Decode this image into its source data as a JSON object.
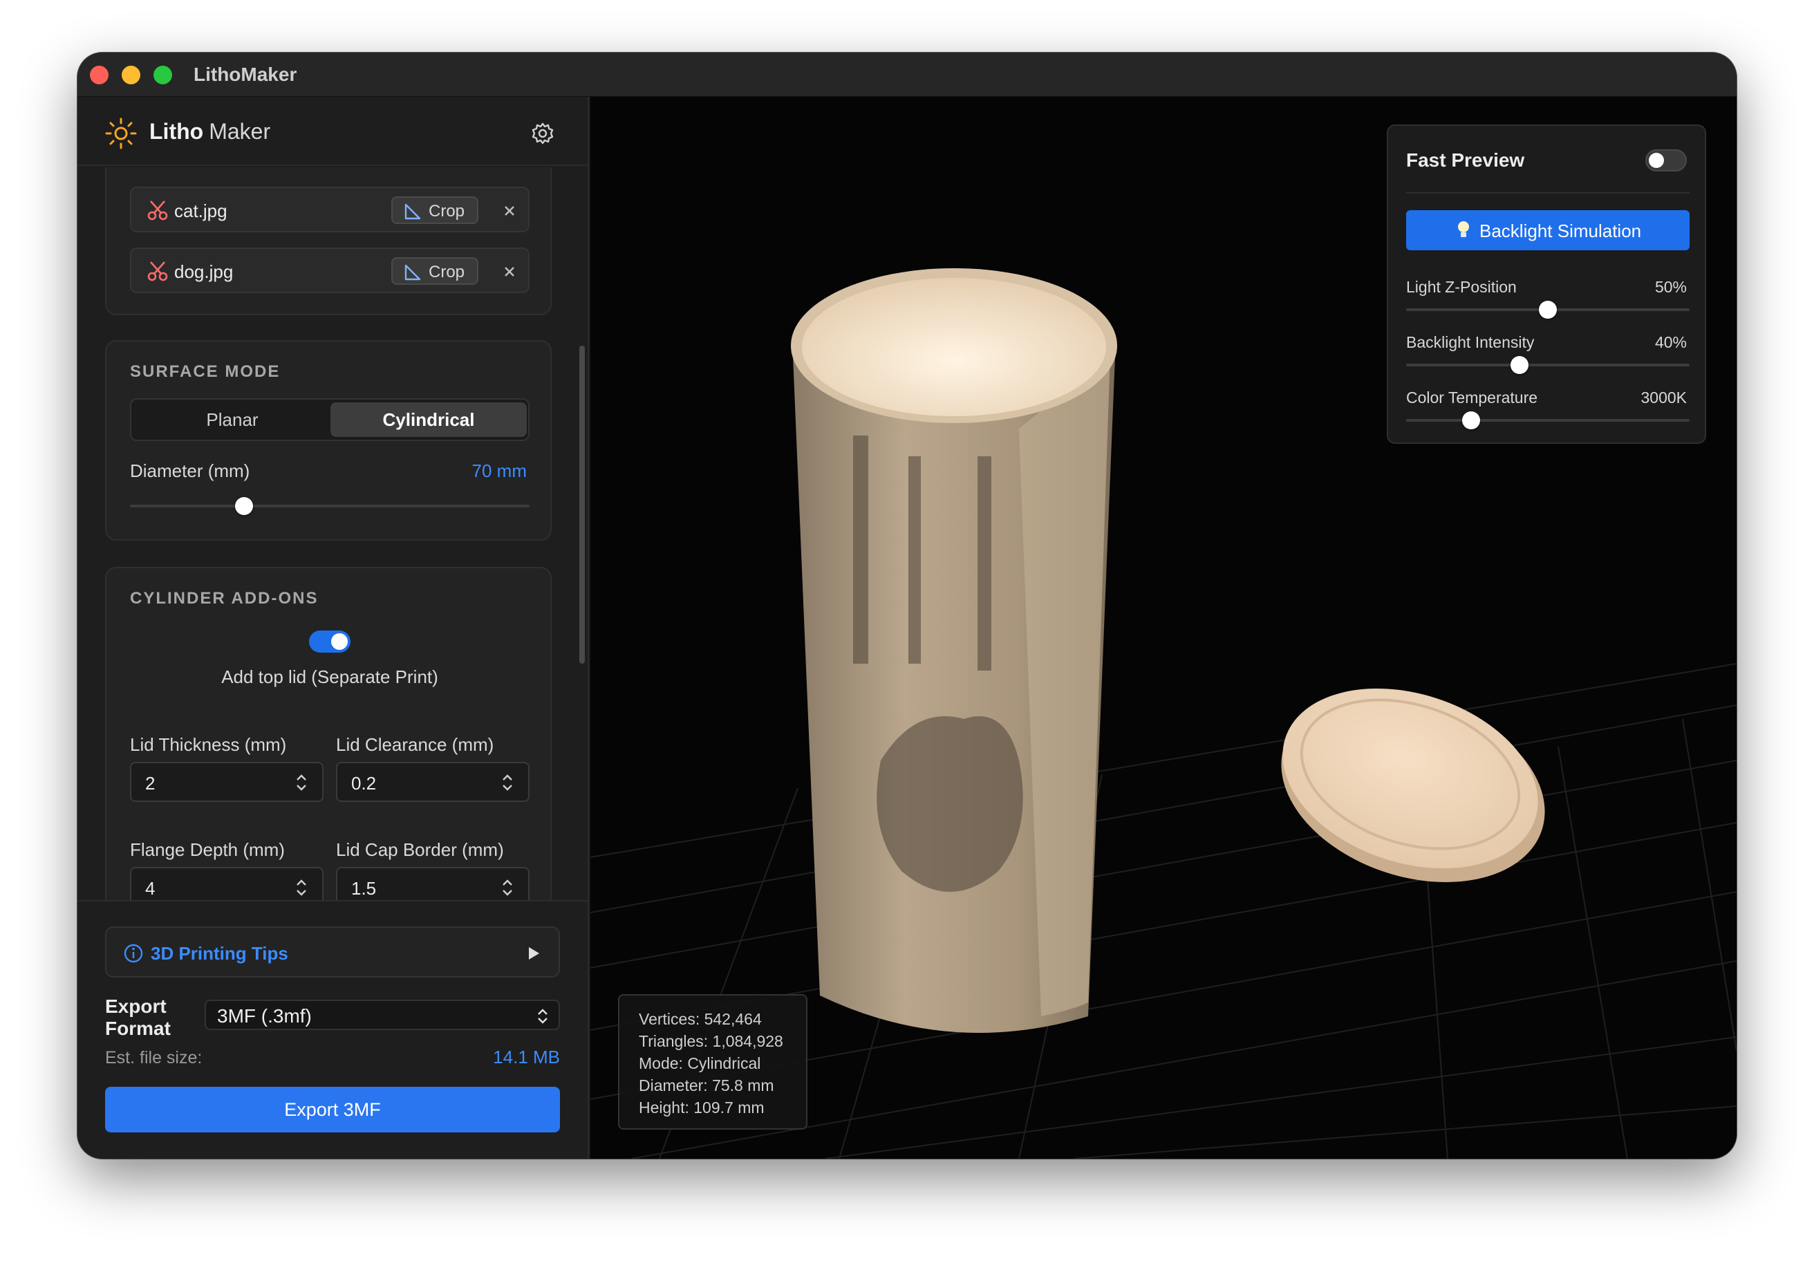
{
  "window": {
    "title": "LithoMaker"
  },
  "sidebar": {
    "brand_primary": "Litho",
    "brand_secondary": "Maker",
    "files": [
      {
        "name": "cat.jpg",
        "crop_label": "Crop"
      },
      {
        "name": "dog.jpg",
        "crop_label": "Crop"
      }
    ],
    "surface_mode": {
      "title": "SURFACE MODE",
      "options": [
        "Planar",
        "Cylindrical"
      ],
      "selected": "Cylindrical",
      "diameter_label": "Diameter (mm)",
      "diameter_value": "70 mm",
      "diameter_fraction": 0.285
    },
    "cylinder_addons": {
      "title": "CYLINDER ADD-ONS",
      "lid_toggle_label": "Add top lid (Separate Print)",
      "lid_toggle_on": true,
      "fields": [
        {
          "label": "Lid Thickness (mm)",
          "value": "2"
        },
        {
          "label": "Lid Clearance (mm)",
          "value": "0.2"
        },
        {
          "label": "Flange Depth (mm)",
          "value": "4"
        },
        {
          "label": "Lid Cap Border (mm)",
          "value": "1.5"
        }
      ]
    },
    "tips_label": "3D Printing Tips",
    "export_format_label": "Export Format",
    "export_format_value": "3MF (.3mf)",
    "est_size_label": "Est. file size:",
    "est_size_value": "14.1 MB",
    "export_button": "Export 3MF"
  },
  "preview": {
    "fast_preview_label": "Fast Preview",
    "fast_preview_on": false,
    "backlight_button": "Backlight Simulation",
    "sliders": [
      {
        "label": "Light Z-Position",
        "value": "50%",
        "fraction": 0.5
      },
      {
        "label": "Backlight Intensity",
        "value": "40%",
        "fraction": 0.4
      },
      {
        "label": "Color Temperature",
        "value": "3000K",
        "fraction": 0.23
      }
    ]
  },
  "stats": [
    "Vertices: 542,464",
    "Triangles: 1,084,928",
    "Mode: Cylindrical",
    "Diameter: 75.8 mm",
    "Height: 109.7 mm"
  ],
  "colors": {
    "accent": "#1f6feb",
    "accent_text": "#3b8cff",
    "lithophane": "#e9d3b8",
    "sun_icon": "#f5a623",
    "scissors_icon": "#ff6b6b"
  }
}
